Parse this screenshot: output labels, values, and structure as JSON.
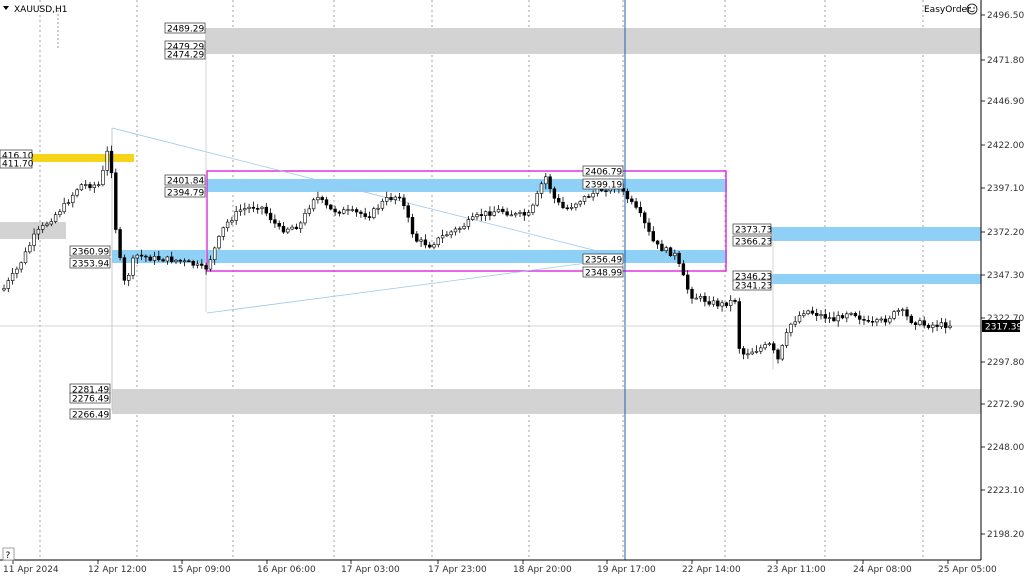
{
  "symbol": "XAUUSD,H1",
  "plugin": "EasyOrder",
  "help": "?",
  "current_price": "2317.39",
  "colors": {
    "zone_blue": "#8fd0f7",
    "zone_grey": "#d3d3d3",
    "zone_yellow": "#f5d41a",
    "rect_magenta": "#e033e0",
    "vline": "#1f5fb0",
    "trend": "#9cc7ea",
    "candle": "#000000"
  },
  "price_axis": [
    "2496.50",
    "2471.80",
    "2446.90",
    "2422.00",
    "2397.10",
    "2372.20",
    "2347.30",
    "2322.70",
    "2297.80",
    "2272.90",
    "2248.00",
    "2223.10",
    "2198.20"
  ],
  "time_axis": [
    "11 Apr 2024",
    "12 Apr 12:00",
    "15 Apr 09:00",
    "16 Apr 06:00",
    "17 Apr 03:00",
    "17 Apr 23:00",
    "18 Apr 20:00",
    "19 Apr 17:00",
    "22 Apr 14:00",
    "23 Apr 11:00",
    "24 Apr 08:00",
    "25 Apr 05:00"
  ],
  "zones": [
    {
      "type": "grey",
      "top": "2489.29",
      "mid": "2479.29",
      "bottom": "2474.29"
    },
    {
      "type": "yellow",
      "top": "416.10",
      "bottom": "411.70"
    },
    {
      "type": "blue",
      "top": "2401.84",
      "bottom": "2394.79"
    },
    {
      "type": "blue",
      "top": "2360.99",
      "bottom": "2353.94"
    },
    {
      "type": "blue",
      "top": "2406.79",
      "bottom": "2399.19"
    },
    {
      "type": "blue",
      "top": "2356.49",
      "bottom": "2348.99"
    },
    {
      "type": "blue",
      "top": "2373.73",
      "bottom": "2366.23"
    },
    {
      "type": "blue",
      "top": "2346.23",
      "bottom": "2341.23"
    },
    {
      "type": "grey",
      "top": "2281.49",
      "mid": "2276.49",
      "bottom": "2266.49"
    }
  ]
}
